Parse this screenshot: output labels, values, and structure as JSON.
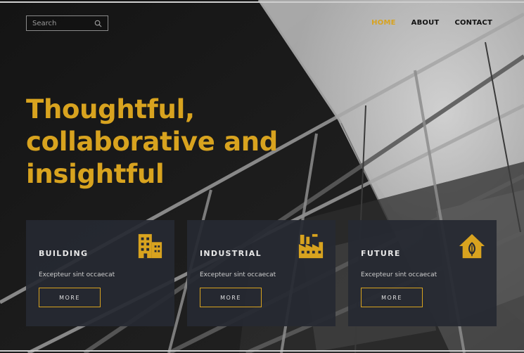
{
  "search": {
    "placeholder": "Search",
    "icon": "search-icon"
  },
  "nav": {
    "items": [
      {
        "label": "HOME",
        "active": true
      },
      {
        "label": "ABOUT",
        "active": false
      },
      {
        "label": "CONTACT",
        "active": false
      }
    ]
  },
  "hero": {
    "headline": "Thoughtful, collaborative and insightful"
  },
  "colors": {
    "accent": "#d8a31f",
    "card_bg": "#262932"
  },
  "cards": [
    {
      "title": "BUILDING",
      "text": "Excepteur sint occaecat",
      "button": "MORE",
      "icon": "building-icon"
    },
    {
      "title": "INDUSTRIAL",
      "text": "Excepteur sint occaecat",
      "button": "MORE",
      "icon": "factory-icon"
    },
    {
      "title": "FUTURE",
      "text": "Excepteur sint occaecat",
      "button": "MORE",
      "icon": "eco-house-icon"
    }
  ]
}
